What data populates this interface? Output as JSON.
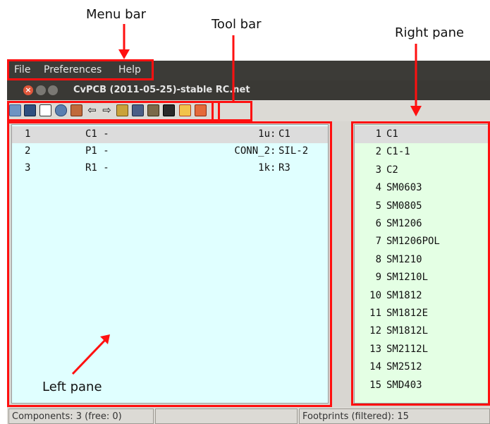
{
  "annotations": {
    "menu_bar": "Menu bar",
    "tool_bar": "Tool bar",
    "right_pane": "Right pane",
    "left_pane": "Left pane"
  },
  "menu": {
    "file": "File",
    "preferences": "Preferences",
    "help": "Help"
  },
  "window": {
    "title": "CvPCB (2011-05-25)-stable RC.net",
    "close_glyph": "×"
  },
  "toolbar": {
    "icons": [
      "open-icon",
      "save-icon",
      "config-icon",
      "library-icon",
      "auto-assoc-icon",
      "prev-icon",
      "next-icon",
      "auto-all-icon",
      "delete-assoc-icon",
      "datasheet-icon",
      "pdf-icon",
      "filter-icon",
      "filter-list-icon"
    ],
    "prev_glyph": "⇦",
    "next_glyph": "⇨"
  },
  "components": [
    {
      "num": "1",
      "ref": "C1 -",
      "value": "1u",
      "sep": ":",
      "footprint": "C1"
    },
    {
      "num": "2",
      "ref": "P1 -",
      "value": "CONN_2",
      "sep": ":",
      "footprint": "SIL-2"
    },
    {
      "num": "3",
      "ref": "R1 -",
      "value": "1k",
      "sep": ":",
      "footprint": "R3"
    }
  ],
  "footprints": [
    {
      "num": "1",
      "name": "C1"
    },
    {
      "num": "2",
      "name": "C1-1"
    },
    {
      "num": "3",
      "name": "C2"
    },
    {
      "num": "4",
      "name": "SM0603"
    },
    {
      "num": "5",
      "name": "SM0805"
    },
    {
      "num": "6",
      "name": "SM1206"
    },
    {
      "num": "7",
      "name": "SM1206POL"
    },
    {
      "num": "8",
      "name": "SM1210"
    },
    {
      "num": "9",
      "name": "SM1210L"
    },
    {
      "num": "10",
      "name": "SM1812"
    },
    {
      "num": "11",
      "name": "SM1812E"
    },
    {
      "num": "12",
      "name": "SM1812L"
    },
    {
      "num": "13",
      "name": "SM2112L"
    },
    {
      "num": "14",
      "name": "SM2512"
    },
    {
      "num": "15",
      "name": "SMD403"
    }
  ],
  "status": {
    "components": "Components: 3 (free: 0)",
    "footprints": "Footprints (filtered): 15"
  },
  "colors": {
    "annotation": "#ff1010",
    "left_pane_bg": "#e0ffff",
    "right_pane_bg": "#e4ffe4",
    "menubar_bg": "#3c3b37"
  }
}
